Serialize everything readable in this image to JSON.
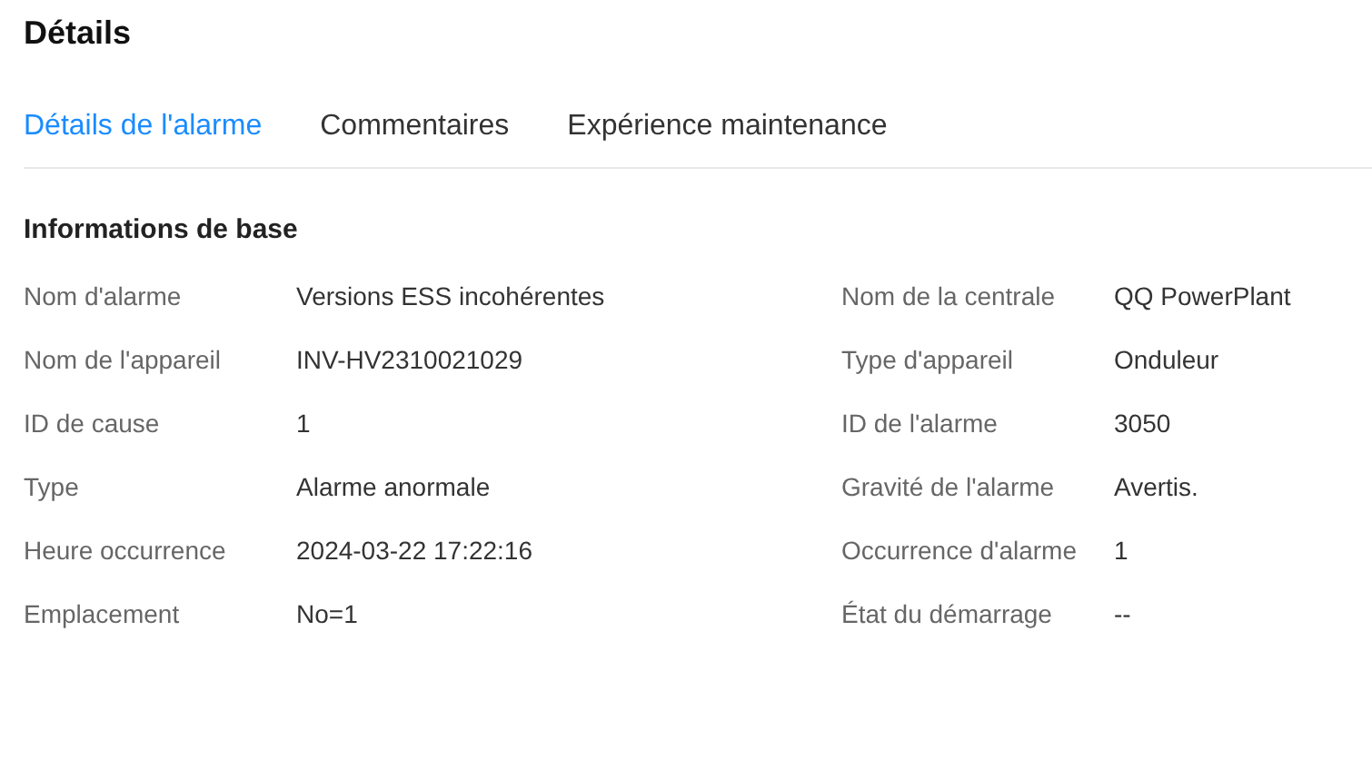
{
  "title": "Détails",
  "tabs": [
    {
      "label": "Détails de l'alarme",
      "selected": true
    },
    {
      "label": "Commentaires",
      "selected": false
    },
    {
      "label": "Expérience maintenance",
      "selected": false
    }
  ],
  "section": {
    "title": "Informations de base",
    "fields": [
      {
        "label": "Nom d'alarme",
        "value": "Versions ESS incohérentes"
      },
      {
        "label": "Nom de la centrale",
        "value": "QQ PowerPlant"
      },
      {
        "label": "Nom de l'appareil",
        "value": "INV-HV2310021029"
      },
      {
        "label": "Type d'appareil",
        "value": "Onduleur"
      },
      {
        "label": "ID de cause",
        "value": "1"
      },
      {
        "label": "ID de l'alarme",
        "value": "3050"
      },
      {
        "label": "Type",
        "value": "Alarme anormale"
      },
      {
        "label": "Gravité de l'alarme",
        "value": "Avertis."
      },
      {
        "label": "Heure occurrence",
        "value": "2024-03-22 17:22:16"
      },
      {
        "label": "Occurrence d'alarme",
        "value": "1"
      },
      {
        "label": "Emplacement",
        "value": "No=1"
      },
      {
        "label": "État du démarrage",
        "value": "--"
      }
    ]
  }
}
